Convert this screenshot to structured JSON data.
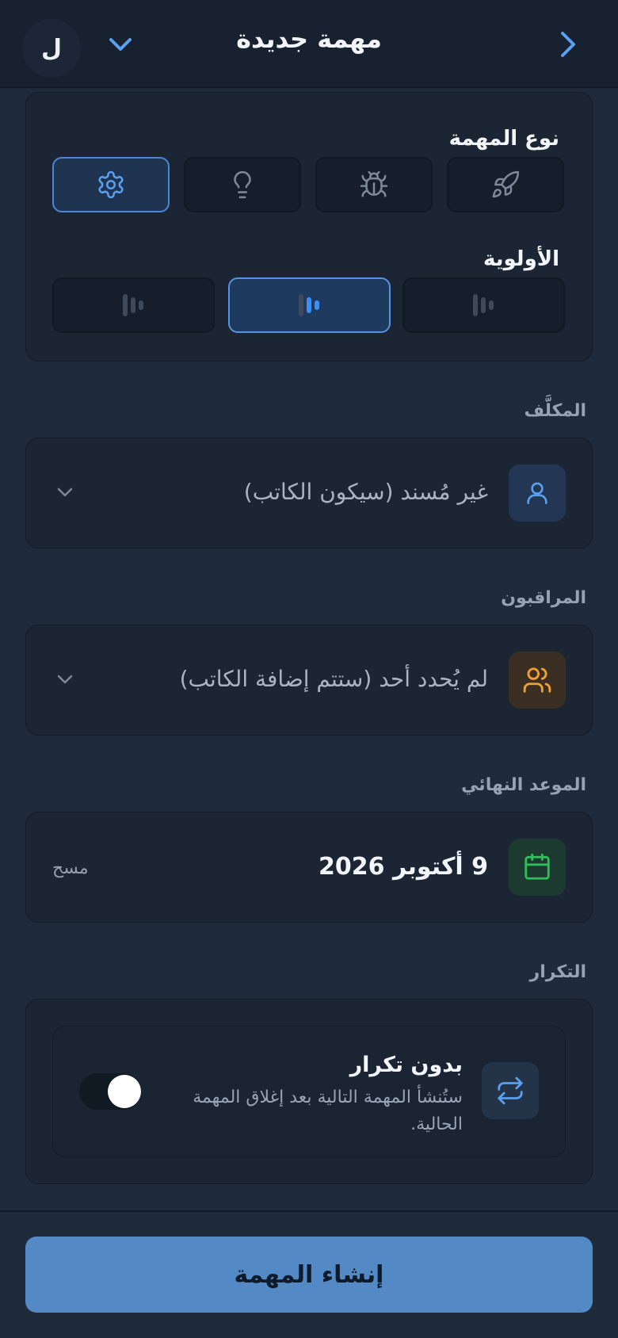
{
  "header": {
    "title": "مهمة جديدة",
    "avatar_initial": "ل",
    "back_icon": "chevron-right-icon",
    "menu_icon": "chevron-down-icon"
  },
  "task_type": {
    "label": "نوع المهمة",
    "options": [
      "rocket-icon",
      "bug-icon",
      "lightbulb-icon",
      "gear-icon"
    ],
    "selected": "gear-icon"
  },
  "priority": {
    "label": "الأولوية",
    "options": [
      "priority-bars-icon",
      "priority-bars-icon",
      "priority-bars-icon"
    ],
    "selected_index": 1
  },
  "assignee": {
    "label": "المكلَّف",
    "value": "غير مُسند (سيكون الكاتب)",
    "icon": "user-icon"
  },
  "watchers": {
    "label": "المراقبون",
    "value": "لم يُحدد أحد (ستتم إضافة الكاتب)",
    "icon": "users-icon"
  },
  "deadline": {
    "label": "الموعد النهائي",
    "value": "9 أكتوبر 2026",
    "clear_label": "مسح",
    "icon": "calendar-icon"
  },
  "recurrence": {
    "label": "التكرار",
    "title": "بدون تكرار",
    "description": "ستُنشأ المهمة التالية بعد إغلاق المهمة الحالية.",
    "icon": "repeat-icon"
  },
  "submit": {
    "label": "إنشاء المهمة"
  },
  "colors": {
    "accent_blue": "#5aa0f0",
    "watchers_orange": "#f0a030",
    "calendar_green": "#2fbf5a",
    "submit_button": "#5389c4"
  }
}
